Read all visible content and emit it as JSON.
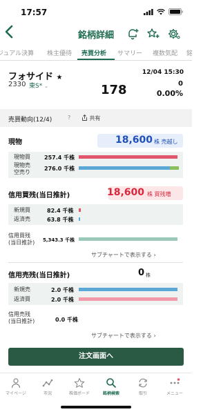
{
  "status": {
    "time": "17:57"
  },
  "nav": {
    "title": "銘柄詳細"
  },
  "tabs": [
    {
      "label": "ジュアル決算"
    },
    {
      "label": "株主優待"
    },
    {
      "label": "売買分析"
    },
    {
      "label": "サマリー"
    },
    {
      "label": "複数気配"
    },
    {
      "label": "銘"
    }
  ],
  "stock": {
    "name": "フォサイド",
    "star": "★",
    "code": "2330",
    "market": "東S*",
    "datetime": "12/04 15:30",
    "price": "178",
    "change": "0",
    "change_pct": "0.00%"
  },
  "section": {
    "title": "売買動向(12/4)",
    "help": "?",
    "share": "共有"
  },
  "genbutsu": {
    "title": "現物",
    "pill_value": "18,600",
    "pill_unit": "株 売越し",
    "buy_label": "現物買",
    "buy_value": "257.4 千株",
    "sell_label": "現物売\n空売り",
    "sell_value": "276.0 千株",
    "buy_ratio": 0.98,
    "sell_ratio_main": 0.91,
    "sell_ratio_short": 0.09
  },
  "shinyo_kaizan": {
    "title": "信用買残(当日推計)",
    "pill_value": "18,600",
    "pill_unit": "株 買残増",
    "new_label": "新規買",
    "new_value": "82.4 千株",
    "repay_label": "返済売",
    "repay_value": "63.8 千株",
    "balance_label": "信用買残\n(当日推計)",
    "balance_value": "5,343.3 千株",
    "link": "サブチャートで表示する ›"
  },
  "shinyo_urizan": {
    "title": "信用売残(当日推計)",
    "value": "0",
    "unit": "株",
    "new_label": "新規売",
    "new_value": "2.0 千株",
    "repay_label": "返済買",
    "repay_value": "2.0 千株",
    "balance_label": "信用売残\n(当日推計)",
    "balance_value": "0.0 千株",
    "link": "サブチャートで表示する ›"
  },
  "order_button": "注文画面へ",
  "bottom_nav": [
    {
      "label": "マイページ",
      "icon": "person-icon"
    },
    {
      "label": "市況",
      "icon": "market-icon"
    },
    {
      "label": "株価ボード",
      "icon": "star-icon"
    },
    {
      "label": "銘柄検索",
      "icon": "search-icon"
    },
    {
      "label": "取引",
      "icon": "trade-icon"
    },
    {
      "label": "メニュー",
      "icon": "menu-icon"
    }
  ],
  "colors": {
    "brand": "#1e6b4f",
    "red": "#e0566a",
    "blue": "#5ba7d6",
    "green": "#8bbf5a",
    "pill_blue_bg": "#e6eefc",
    "pill_blue_text": "#1f4fb8",
    "pill_red_bg": "#fce6e8",
    "pill_red_text": "#d9283b"
  }
}
